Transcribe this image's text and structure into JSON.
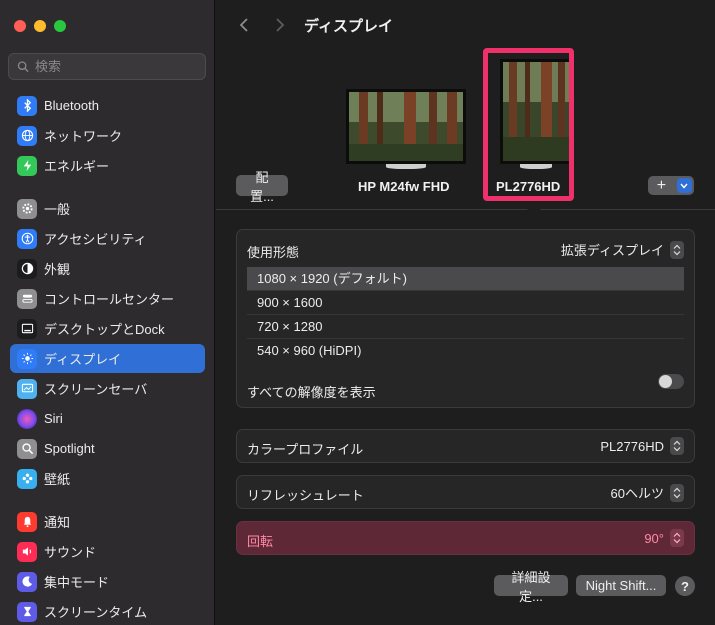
{
  "sidebar": {
    "search_placeholder": "検索",
    "items": [
      {
        "label": "Bluetooth",
        "icon": "bluetooth-icon",
        "color": "#2f7cf6"
      },
      {
        "label": "ネットワーク",
        "icon": "globe-icon",
        "color": "#2f7cf6"
      },
      {
        "label": "エネルギー",
        "icon": "bolt-icon",
        "color": "#34c759"
      },
      {
        "label": "一般",
        "icon": "gear-icon",
        "color": "#8e8e93"
      },
      {
        "label": "アクセシビリティ",
        "icon": "accessibility-icon",
        "color": "#2f7cf6"
      },
      {
        "label": "外観",
        "icon": "appearance-icon",
        "color": "#1c1c1e"
      },
      {
        "label": "コントロールセンター",
        "icon": "control-center-icon",
        "color": "#8e8e93"
      },
      {
        "label": "デスクトップとDock",
        "icon": "dock-icon",
        "color": "#1c1c1e"
      },
      {
        "label": "ディスプレイ",
        "icon": "sun-icon",
        "color": "#2f7cf6"
      },
      {
        "label": "スクリーンセーバ",
        "icon": "screensaver-icon",
        "color": "#4fb2f0"
      },
      {
        "label": "Siri",
        "icon": "siri-icon",
        "color": "#c64bd4"
      },
      {
        "label": "Spotlight",
        "icon": "magnifier-icon",
        "color": "#8e8e93"
      },
      {
        "label": "壁紙",
        "icon": "flower-icon",
        "color": "#38b0f0"
      },
      {
        "label": "通知",
        "icon": "bell-icon",
        "color": "#ff3b30"
      },
      {
        "label": "サウンド",
        "icon": "speaker-icon",
        "color": "#ff2d55"
      },
      {
        "label": "集中モード",
        "icon": "moon-icon",
        "color": "#5e5ce6"
      },
      {
        "label": "スクリーンタイム",
        "icon": "hourglass-icon",
        "color": "#5e5ce6"
      }
    ]
  },
  "header": {
    "title": "ディスプレイ"
  },
  "arrangement": {
    "arrange_button": "配置...",
    "monitor_a_name": "HP M24fw FHD",
    "monitor_b_name": "PL2776HD",
    "add_symbol": "+"
  },
  "settings": {
    "usage_label": "使用形態",
    "usage_value": "拡張ディスプレイ",
    "resolutions": [
      "1080 × 1920 (デフォルト)",
      "900 × 1600",
      "720 × 1280",
      "540 × 960 (HiDPI)"
    ],
    "show_all_label": "すべての解像度を表示",
    "color_profile_label": "カラープロファイル",
    "color_profile_value": "PL2776HD",
    "refresh_label": "リフレッシュレート",
    "refresh_value": "60ヘルツ",
    "rotation_label": "回転",
    "rotation_value": "90°"
  },
  "footer": {
    "advanced_button": "詳細設定...",
    "night_shift_button": "Night Shift...",
    "help_symbol": "?"
  },
  "colors": {
    "accent": "#2f6fd6",
    "highlight": "#f0306a",
    "rotation_bg": "#5e2837"
  }
}
